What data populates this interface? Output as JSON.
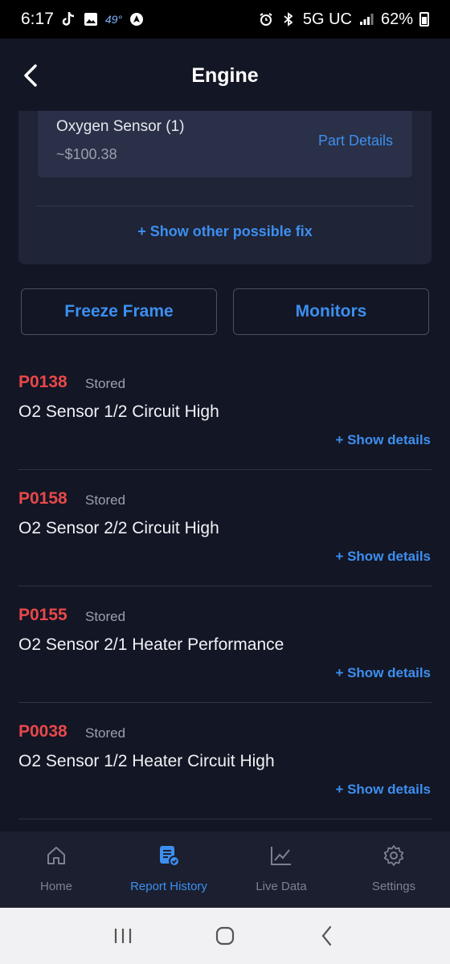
{
  "status_bar": {
    "time": "6:17",
    "temperature": "49°",
    "network": "5G UC",
    "battery": "62%"
  },
  "header": {
    "title": "Engine"
  },
  "fix_card": {
    "part_name": "Oxygen Sensor (1)",
    "part_price": "~$100.38",
    "part_details_label": "Part Details",
    "show_other_fix_label": "+ Show other possible fix"
  },
  "buttons": {
    "freeze_frame": "Freeze Frame",
    "monitors": "Monitors"
  },
  "dtcs": [
    {
      "code": "P0138",
      "status": "Stored",
      "description": "O2 Sensor 1/2 Circuit High",
      "show_label": "+ Show details"
    },
    {
      "code": "P0158",
      "status": "Stored",
      "description": "O2 Sensor 2/2 Circuit High",
      "show_label": "+ Show details"
    },
    {
      "code": "P0155",
      "status": "Stored",
      "description": "O2 Sensor 2/1 Heater Performance",
      "show_label": "+ Show details"
    },
    {
      "code": "P0038",
      "status": "Stored",
      "description": "O2 Sensor 1/2 Heater Circuit High",
      "show_label": "+ Show details"
    }
  ],
  "bottom_nav": [
    {
      "label": "Home",
      "icon": "home-icon",
      "active": false
    },
    {
      "label": "Report History",
      "icon": "report-icon",
      "active": true
    },
    {
      "label": "Live Data",
      "icon": "chart-icon",
      "active": false
    },
    {
      "label": "Settings",
      "icon": "gear-icon",
      "active": false
    }
  ],
  "colors": {
    "background": "#131624",
    "accent": "#3c8ff0",
    "error_code": "#e8484a"
  }
}
